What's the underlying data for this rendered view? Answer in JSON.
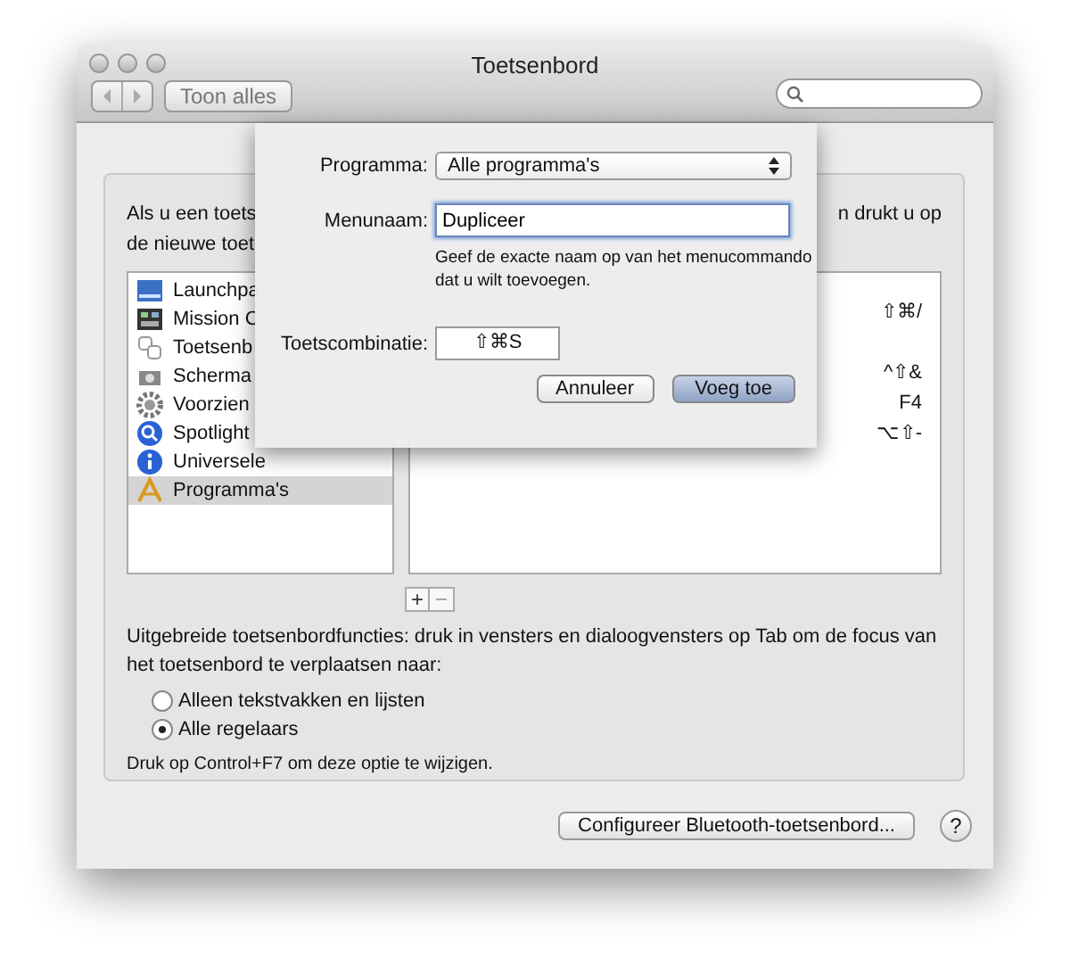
{
  "window": {
    "title": "Toetsenbord"
  },
  "toolbar": {
    "show_all_button": "Toon alles"
  },
  "intro": {
    "left": "Als u een toets",
    "right": "n drukt u op",
    "line_2": "de nieuwe toet"
  },
  "categories": [
    {
      "label": "Launchpa",
      "selected": false
    },
    {
      "label": "Mission C",
      "selected": false
    },
    {
      "label": "Toetsenb",
      "selected": false
    },
    {
      "label": "Scherma",
      "selected": false
    },
    {
      "label": "Voorzien",
      "selected": false
    },
    {
      "label": "Spotlight",
      "selected": false
    },
    {
      "label": "Universele",
      "selected": false
    },
    {
      "label": "Programma's",
      "selected": true
    }
  ],
  "shortcuts": [
    "⇧⌘/",
    "^⇧&",
    "F4",
    "⌥⇧-"
  ],
  "add_remove": [
    "+",
    "−"
  ],
  "full_keyboard_access": {
    "text": "Uitgebreide toetsenbordfuncties: druk in vensters en dialoogvensters op Tab om de focus van het toetsenbord te verplaatsen naar:",
    "options": [
      {
        "label": "Alleen tekstvakken en lijsten",
        "selected": false
      },
      {
        "label": "Alle regelaars",
        "selected": true
      }
    ],
    "hint": "Druk op Control+F7 om deze optie te wijzigen."
  },
  "bluetooth_button": "Configureer Bluetooth-toetsenbord...",
  "help_button": "?",
  "sheet": {
    "program_label": "Programma:",
    "program_value": "Alle programma's",
    "menu_label": "Menunaam:",
    "menu_value": "Dupliceer",
    "menu_hint": "Geef de exacte naam op van het menucommando dat u wilt toevoegen.",
    "shortcut_label": "Toetscombinatie:",
    "shortcut_value": "⇧⌘S",
    "buttons": [
      {
        "label": "Annuleer",
        "kind": "cancel"
      },
      {
        "label": "Voeg toe",
        "kind": "default"
      }
    ]
  }
}
